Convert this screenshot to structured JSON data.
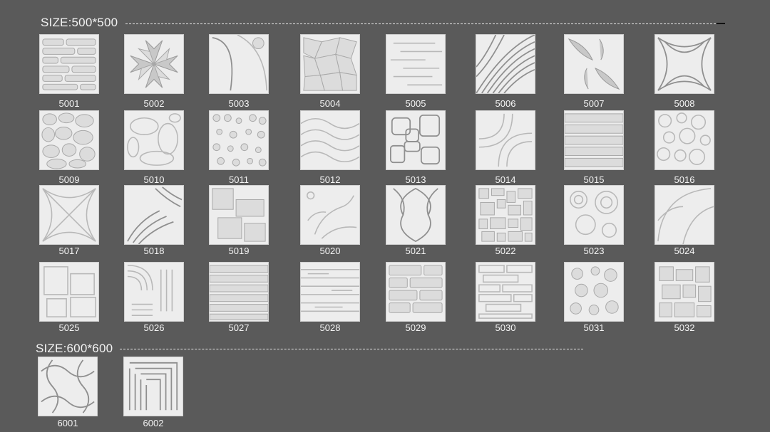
{
  "sections": [
    {
      "title": "SIZE:500*500",
      "codes": [
        "5001",
        "5002",
        "5003",
        "5004",
        "5005",
        "5006",
        "5007",
        "5008",
        "5009",
        "5010",
        "5011",
        "5012",
        "5013",
        "5014",
        "5015",
        "5016",
        "5017",
        "5018",
        "5019",
        "5020",
        "5021",
        "5022",
        "5023",
        "5024",
        "5025",
        "5026",
        "5027",
        "5028",
        "5029",
        "5030",
        "5031",
        "5032"
      ]
    },
    {
      "title": "SIZE:600*600",
      "codes": [
        "6001",
        "6002"
      ]
    }
  ]
}
